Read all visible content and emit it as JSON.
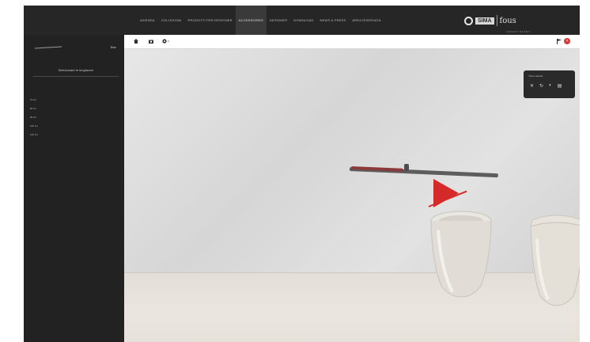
{
  "header": {
    "nav": [
      "AZIENDA",
      "COLLEZIONI",
      "PRODOTTI PER DESIGNER",
      "ACCESSORIES",
      "DESIGNER",
      "DOWNLOAD",
      "NEWS & PRESS",
      "AREA RISERVATA"
    ],
    "active_index": 3
  },
  "logo": {
    "box_text": "SIMA",
    "right_text": "fous",
    "sub_text": "ARREDO BAGNO"
  },
  "sidebar": {
    "heading": "",
    "mini_label": "Box",
    "title": "Selezionare le lunghezze",
    "items": [
      "70 cm",
      "80 cm",
      "90 cm",
      "100 cm",
      "120 cm"
    ]
  },
  "toolbar": {
    "icons": [
      "home-icon",
      "camera-icon",
      "view-icon"
    ],
    "right_icons": [
      "flag-icon",
      "close-icon"
    ]
  },
  "scene_panel": {
    "label": "Vista Laterale",
    "icons": [
      "x-icon",
      "rotate-icon",
      "paint-icon",
      "trash-icon"
    ]
  },
  "colors": {
    "accent_red": "#d52a2a",
    "frame_dark": "#262626",
    "wall_light": "#e0e0e0"
  }
}
